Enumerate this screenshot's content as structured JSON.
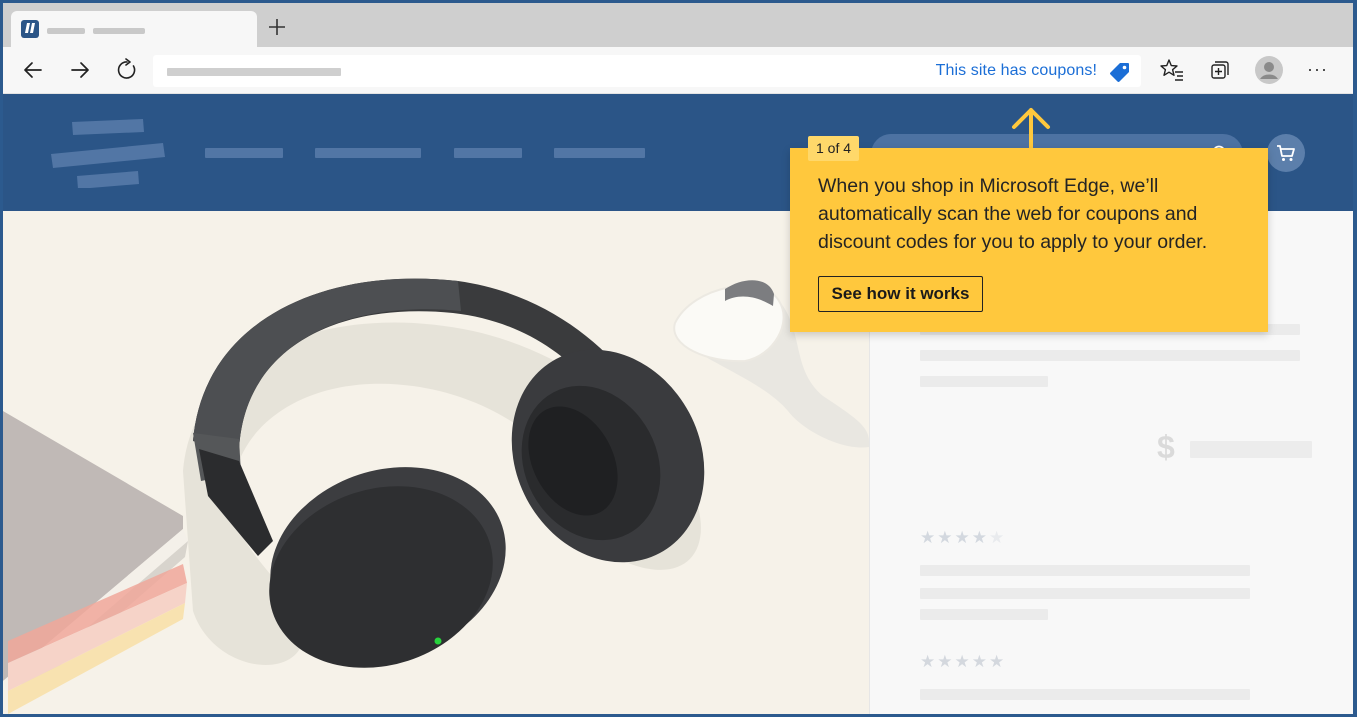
{
  "browser": {
    "new_tab_symbol": "+",
    "coupon_text": "This site has coupons!",
    "more_symbol": "···"
  },
  "icons": {
    "back": "back-arrow-icon",
    "forward": "forward-arrow-icon",
    "refresh": "refresh-icon",
    "coupon": "coupon-tag-icon",
    "favorites": "favorites-star-icon",
    "collections": "collections-icon",
    "profile": "profile-avatar-icon",
    "cart": "shopping-cart-icon",
    "search": "search-icon"
  },
  "callout": {
    "step": "1 of 4",
    "body": "When you shop in Microsoft Edge, we’ll automatically scan the web for coupons and discount codes for you to apply to your order.",
    "button": "See how it works"
  },
  "product": {
    "currency_symbol": "$",
    "review1_stars": "★★★★★",
    "review1_rating": 4,
    "review2_stars": "★★★★★"
  },
  "colors": {
    "accent_blue": "#2b5587",
    "callout_yellow": "#ffc83d",
    "coupon_blue": "#1b6ed6"
  }
}
